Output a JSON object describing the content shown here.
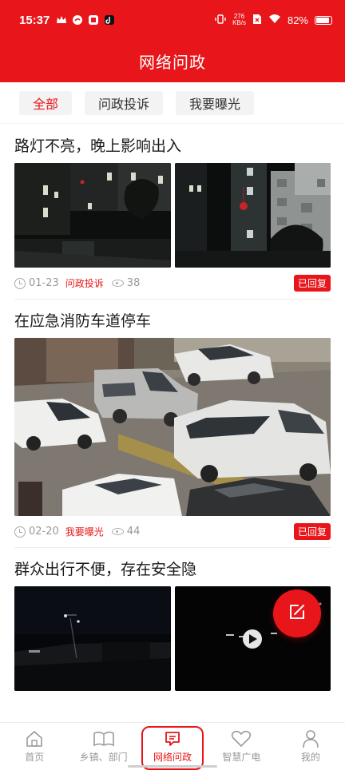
{
  "status_bar": {
    "time": "15:37",
    "net_speed_value": "276",
    "net_speed_unit": "KB/s",
    "battery": "82%",
    "left_icons": [
      "crown-icon",
      "weibo-icon",
      "app-badge-icon",
      "tiktok-icon"
    ],
    "right_icons": [
      "vibrate-icon",
      "sim-icon",
      "wifi-icon",
      "battery-icon"
    ]
  },
  "header": {
    "title": "网络问政"
  },
  "tabs": [
    {
      "label": "全部",
      "active": true
    },
    {
      "label": "问政投诉",
      "active": false
    },
    {
      "label": "我要曝光",
      "active": false
    }
  ],
  "posts": [
    {
      "title": "路灯不亮，晚上影响出入",
      "date": "01-23",
      "category": "问政投诉",
      "views": "38",
      "status": "已回复",
      "images": [
        "night-building-photo",
        "night-building-photo"
      ]
    },
    {
      "title": "在应急消防车道停车",
      "date": "02-20",
      "category": "我要曝光",
      "views": "44",
      "status": "已回复",
      "images": [
        "parked-cars-photo"
      ]
    },
    {
      "title": "群众出行不便，存在安全隐",
      "images": [
        "dark-street-photo",
        "dark-video-thumbnail"
      ]
    }
  ],
  "bottom_nav": [
    {
      "label": "首页",
      "icon": "home-icon",
      "active": false
    },
    {
      "label": "乡镇、部门",
      "icon": "book-icon",
      "active": false
    },
    {
      "label": "网络问政",
      "icon": "message-icon",
      "active": true
    },
    {
      "label": "智慧广电",
      "icon": "heart-icon",
      "active": false
    },
    {
      "label": "我的",
      "icon": "user-icon",
      "active": false
    }
  ],
  "colors": {
    "brand_red": "#e8161a",
    "muted": "#999999"
  }
}
